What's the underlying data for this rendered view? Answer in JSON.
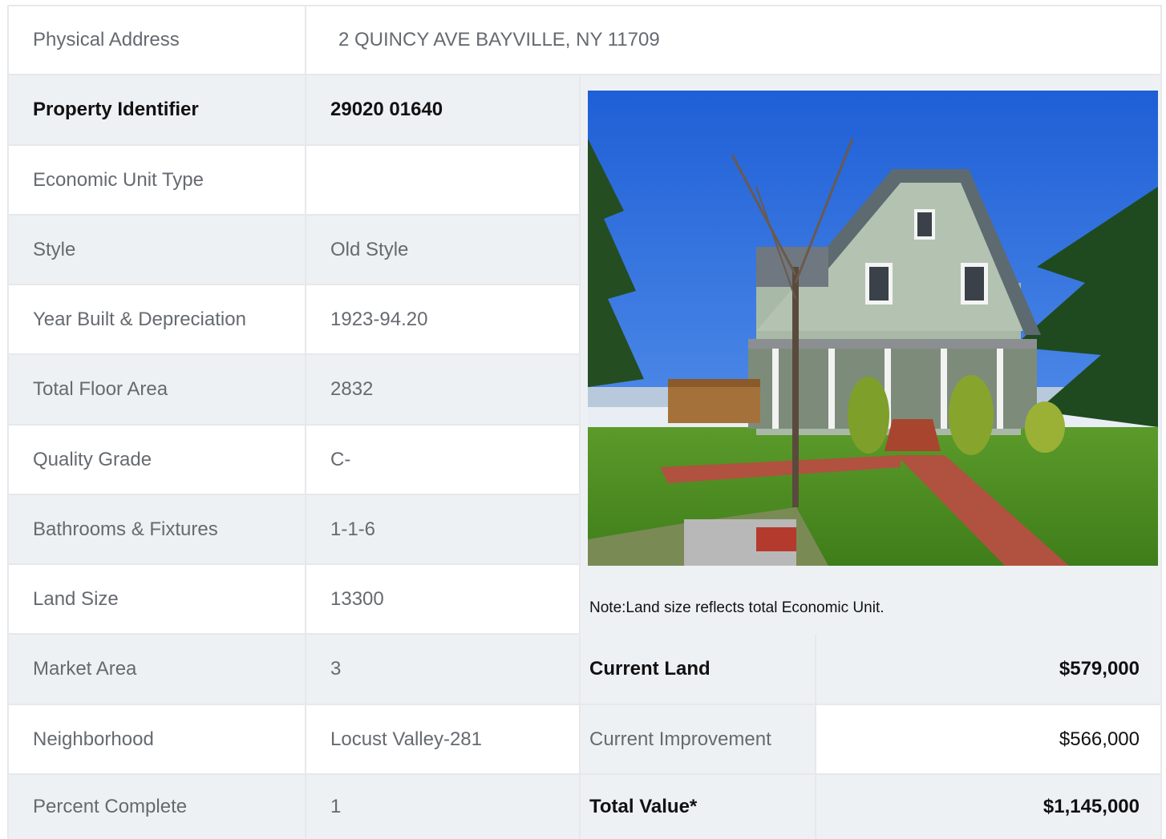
{
  "address": {
    "label": "Physical Address",
    "value": "2  QUINCY AVE  BAYVILLE, NY  11709"
  },
  "rows": [
    {
      "label": "Property Identifier",
      "value": "29020  01640"
    },
    {
      "label": "Economic Unit Type",
      "value": ""
    },
    {
      "label": "Style",
      "value": "Old Style"
    },
    {
      "label": "Year Built & Depreciation",
      "value": "1923-94.20"
    },
    {
      "label": "Total Floor Area",
      "value": "2832"
    },
    {
      "label": "Quality Grade",
      "value": "C-"
    },
    {
      "label": "Bathrooms & Fixtures",
      "value": "1-1-6"
    },
    {
      "label": "Land Size",
      "value": "13300"
    },
    {
      "label": "Market Area",
      "value": "3"
    },
    {
      "label": "Neighborhood",
      "value": "Locust Valley-281"
    },
    {
      "label": "Percent Complete",
      "value": "1"
    }
  ],
  "note": "Note:Land size reflects total Economic Unit.",
  "values": [
    {
      "label": "Current Land",
      "value": "$579,000"
    },
    {
      "label": "Current Improvement",
      "value": "$566,000"
    },
    {
      "label": "Total Value*",
      "value": "$1,145,000"
    }
  ],
  "colors": {
    "shade": "#eef1f4",
    "border": "#e6e8eb",
    "text": "#666a70",
    "bold": "#111111"
  }
}
